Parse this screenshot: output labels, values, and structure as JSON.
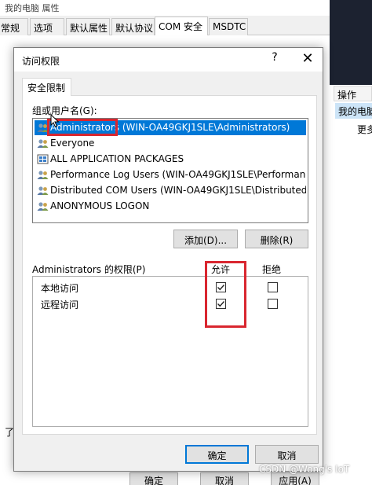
{
  "background": {
    "title_fragment": "我的电脑 属性",
    "tabs": [
      "常规",
      "选项",
      "默认属性",
      "默认协议",
      "COM 安全",
      "MSDTC"
    ],
    "active_tab_index": 4,
    "left_fragments": [
      "访问权限",
      "了"
    ],
    "bottom_buttons": {
      "ok": "确定",
      "cancel": "取消",
      "apply": "应用(A)"
    },
    "mmc": {
      "actions_header": "操作",
      "selected_row": "我的电脑",
      "more": "更多"
    },
    "watermark": "CSDN @Wong's IoT"
  },
  "dialog": {
    "title": "访问权限",
    "help_glyph": "?",
    "close_glyph": "✕",
    "tab": "安全限制",
    "group_label": "组或用户名(G):",
    "principals": [
      {
        "name": "Administrators (WIN-OA49GKJ1SLE\\Administrators)",
        "icon": "group-icon",
        "selected": true
      },
      {
        "name": "Everyone",
        "icon": "group-icon",
        "selected": false
      },
      {
        "name": "ALL APPLICATION PACKAGES",
        "icon": "packages-icon",
        "selected": false
      },
      {
        "name": "Performance Log Users (WIN-OA49GKJ1SLE\\Performance...",
        "icon": "group-icon",
        "selected": false
      },
      {
        "name": "Distributed COM Users (WIN-OA49GKJ1SLE\\Distributed C...",
        "icon": "group-icon",
        "selected": false
      },
      {
        "name": "ANONYMOUS LOGON",
        "icon": "group-icon",
        "selected": false
      }
    ],
    "add_button": "添加(D)...",
    "remove_button": "删除(R)",
    "permissions_label": "Administrators 的权限(P)",
    "allow_header": "允许",
    "deny_header": "拒绝",
    "permissions": [
      {
        "name": "本地访问",
        "allow": true,
        "deny": false
      },
      {
        "name": "远程访问",
        "allow": true,
        "deny": false
      }
    ],
    "ok_button": "确定",
    "cancel_button": "取消",
    "highlight_color": "#d9262f",
    "selection_color": "#0078d7"
  }
}
